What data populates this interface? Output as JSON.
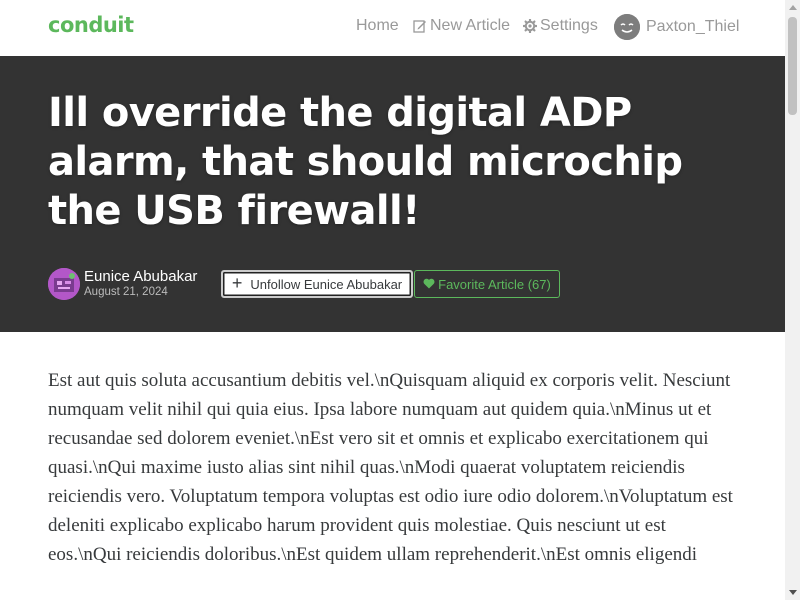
{
  "nav": {
    "brand": "conduit",
    "home": "Home",
    "new_article": "New Article",
    "settings": "Settings",
    "username": "Paxton_Thiel"
  },
  "article": {
    "title": "Ill override the digital ADP alarm, that should microchip the USB firewall!",
    "author": "Eunice Abubakar",
    "date": "August 21, 2024",
    "unfollow_label": "Unfollow Eunice Abubakar",
    "favorite_label": "Favorite Article (67)",
    "body": "Est aut quis soluta accusantium debitis vel.\\nQuisquam aliquid ex corporis velit. Nesciunt numquam velit nihil qui quia eius. Ipsa labore numquam aut quidem quia.\\nMinus ut et recusandae sed dolorem eveniet.\\nEst vero sit et omnis et explicabo exercitationem qui quasi.\\nQui maxime iusto alias sint nihil quas.\\nModi quaerat voluptatem reiciendis reiciendis vero. Voluptatum tempora voluptas est odio iure odio dolorem.\\nVoluptatum est deleniti explicabo explicabo harum provident quis molestiae. Quis nesciunt ut est eos.\\nQui reiciendis doloribus.\\nEst quidem ullam reprehenderit.\\nEst omnis eligendi"
  },
  "colors": {
    "accent": "#5cb85c",
    "banner": "#333333",
    "nav_text": "#999999"
  },
  "icons": {
    "new_article": "edit-icon",
    "settings": "gear-icon",
    "user": "smiley-avatar-icon",
    "unfollow": "plus-icon",
    "favorite": "heart-icon"
  }
}
